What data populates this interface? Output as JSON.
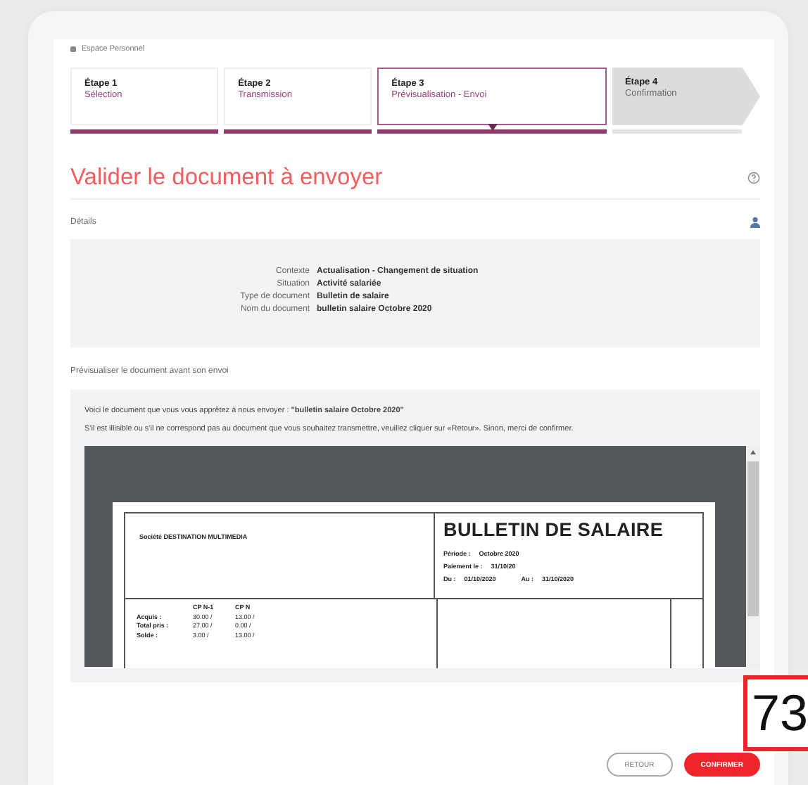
{
  "breadcrumb": "Espace Personnel",
  "steps": [
    {
      "label": "Étape 1",
      "name": "Sélection",
      "completed": true,
      "selected": false
    },
    {
      "label": "Étape 2",
      "name": "Transmission",
      "completed": true,
      "selected": false
    },
    {
      "label": "Étape 3",
      "name": "Prévisualisation - Envoi",
      "completed": true,
      "selected": true
    },
    {
      "label": "Étape 4",
      "name": "Confirmation",
      "completed": false,
      "selected": false
    }
  ],
  "title": "Valider le document à envoyer",
  "details": {
    "heading": "Détails",
    "rows": [
      {
        "label": "Contexte",
        "value": "Actualisation - Changement de situation"
      },
      {
        "label": "Situation",
        "value": "Activité salariée"
      },
      {
        "label": "Type de document",
        "value": "Bulletin de salaire"
      },
      {
        "label": "Nom du document",
        "value": "bulletin salaire Octobre 2020"
      }
    ]
  },
  "preview": {
    "heading": "Prévisualiser le document avant son envoi",
    "intro": "Voici le document que vous vous apprêtez à nous envoyer : **\"bulletin salaire Octobre 2020\"**",
    "instruction": "S'il est illisible ou s'il ne correspond pas au document que vous souhaitez transmettre, veuillez cliquer sur «Retour». Sinon, merci de confirmer.",
    "document": {
      "company": "Société DESTINATION MULTIMEDIA",
      "title": "BULLETIN DE SALAIRE",
      "info": [
        {
          "label": "Période :",
          "value": "Octobre 2020"
        },
        {
          "label": "Paiement le :",
          "value": "31/10/20"
        }
      ],
      "period": {
        "from_label": "Du :",
        "from": "01/10/2020",
        "to_label": "Au :",
        "to": "31/10/2020"
      },
      "leave_columns": [
        "CP N-1",
        "CP N"
      ],
      "leave_rows": [
        {
          "label": "Acquis :",
          "values": [
            "30.00 /",
            "13.00 /"
          ]
        },
        {
          "label": "Total pris :",
          "values": [
            "27.00 /",
            "0.00 /"
          ]
        },
        {
          "label": "Solde :",
          "values": [
            "3.00 /",
            "13.00 /"
          ]
        }
      ]
    }
  },
  "buttons": [
    {
      "label": "RETOUR",
      "kind": "secondary"
    },
    {
      "label": "CONFIRMER",
      "kind": "primary"
    }
  ],
  "corner_badge": "73"
}
